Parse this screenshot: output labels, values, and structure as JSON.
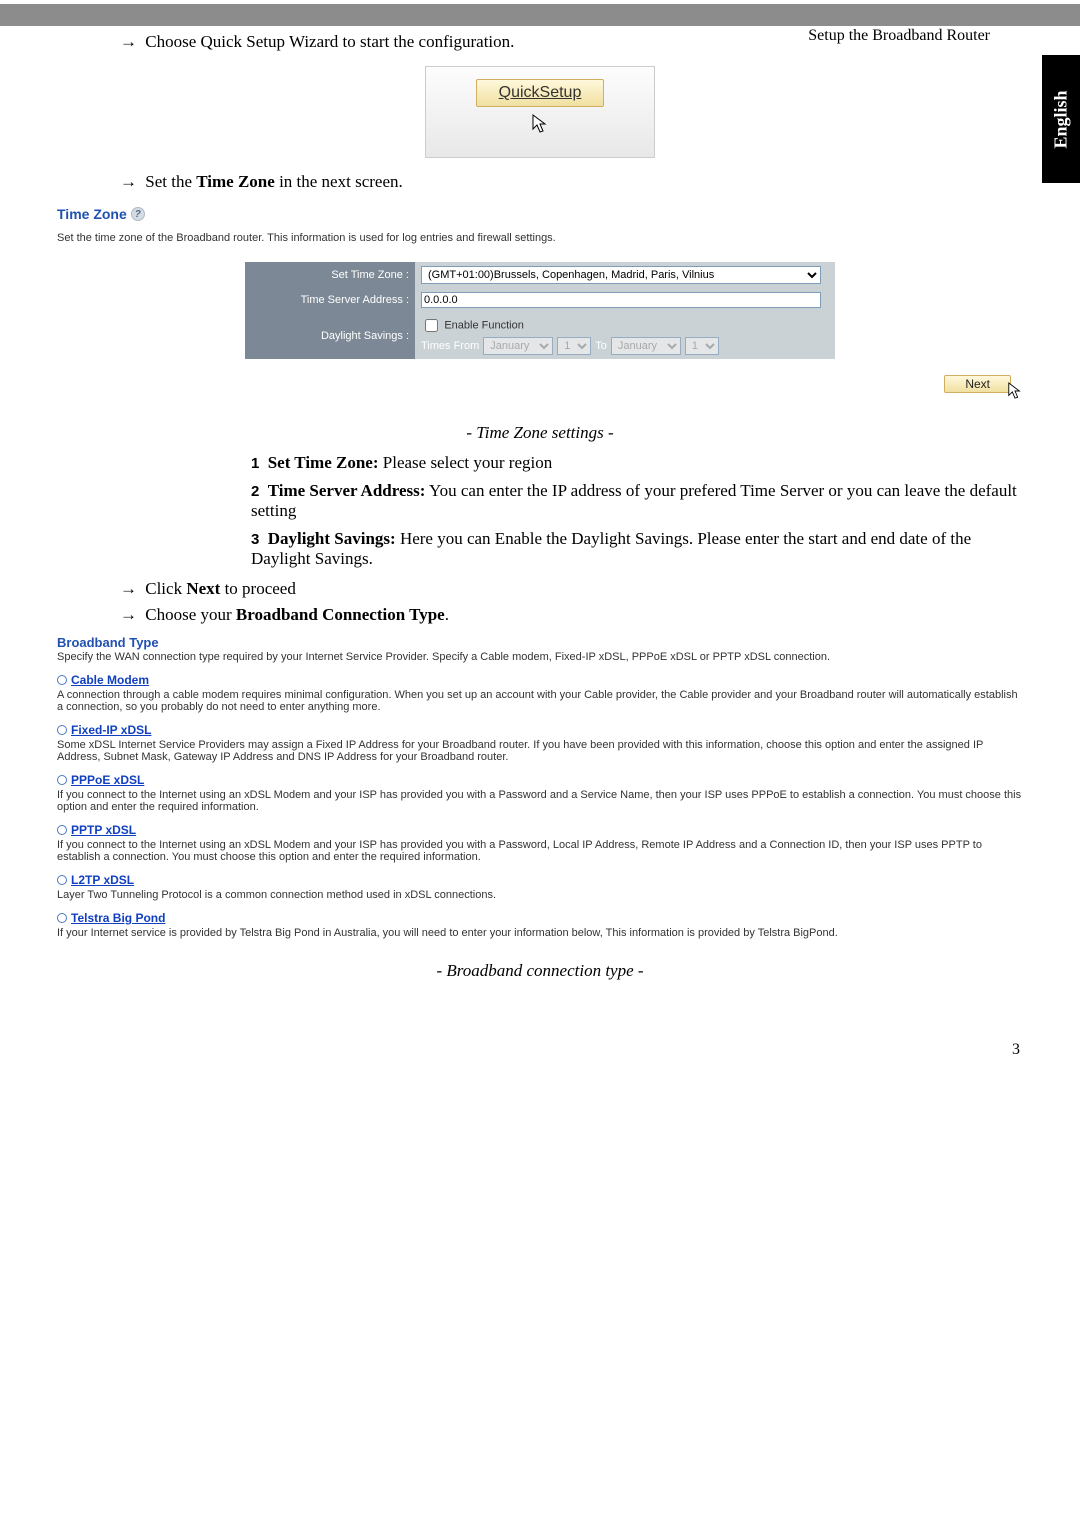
{
  "header": {
    "title": "Setup the Broadband Router",
    "language_tab": "English"
  },
  "intro": {
    "step1": "Choose Quick Setup Wizard to start the configuration.",
    "quick_setup_button": "QuickSetup",
    "step2_prefix": "Set the ",
    "step2_bold": "Time Zone",
    "step2_suffix": " in the next screen."
  },
  "timezone_panel": {
    "title": "Time Zone",
    "desc": "Set the time zone of the Broadband router. This information is used for log entries and firewall settings.",
    "rows": {
      "set_tz_label": "Set Time Zone :",
      "set_tz_value": "(GMT+01:00)Brussels, Copenhagen, Madrid, Paris, Vilnius",
      "tsa_label": "Time Server Address :",
      "tsa_value": "0.0.0.0",
      "ds_label": "Daylight Savings :",
      "ds_enable": "Enable Function",
      "ds_from": "Times From",
      "ds_to": "To",
      "month1": "January",
      "day1": "1",
      "month2": "January",
      "day2": "1"
    },
    "next_button": "Next"
  },
  "captions": {
    "tz": "- Time Zone settings -",
    "bt": "- Broadband connection type -"
  },
  "numbered": [
    {
      "label": "Set Time Zone:",
      "text": " Please select your region"
    },
    {
      "label": "Time Server Address:",
      "text": " You can enter the IP address of your prefered Time Server or you can leave the default setting"
    },
    {
      "label": "Daylight Savings:",
      "text": " Here you can Enable the Daylight Savings. Please enter the start and end date of the Daylight Savings."
    }
  ],
  "after_list": {
    "click_next_prefix": "Click ",
    "click_next_bold": "Next",
    "click_next_suffix": " to proceed",
    "choose_bct_prefix": "Choose your ",
    "choose_bct_bold": "Broadband Connection Type",
    "choose_bct_suffix": "."
  },
  "broadband": {
    "title": "Broadband Type",
    "intro": "Specify the WAN connection type required by your Internet Service Provider. Specify a Cable modem, Fixed-IP xDSL, PPPoE xDSL or PPTP xDSL connection.",
    "options": [
      {
        "name": " Cable Modem",
        "text": "A connection through a cable modem requires minimal configuration. When you set up an account with your Cable provider, the Cable provider and your Broadband router will automatically establish a connection, so you probably do not need to enter anything more."
      },
      {
        "name": " Fixed-IP xDSL",
        "text": "Some xDSL Internet Service Providers may assign a Fixed IP Address for your Broadband router. If you have been provided with this information, choose this option and enter the assigned IP Address, Subnet Mask, Gateway IP Address and DNS IP Address for your Broadband router."
      },
      {
        "name": " PPPoE xDSL",
        "text": "If you connect to the Internet using an xDSL Modem and your ISP has provided you with a Password and a Service Name, then your ISP uses PPPoE to establish a connection. You must choose this option and enter the required information."
      },
      {
        "name": " PPTP xDSL",
        "text": "If you connect to the Internet using an xDSL Modem and your ISP has provided you with a Password, Local IP Address, Remote IP Address and a Connection ID, then your ISP uses PPTP to establish a connection. You must choose this option and enter the required information."
      },
      {
        "name": " L2TP xDSL",
        "text": "Layer Two Tunneling Protocol is a common connection method used in xDSL connections."
      },
      {
        "name": " Telstra Big Pond",
        "text": "If your Internet service is provided by Telstra Big Pond in Australia, you will need to enter your information below, This information is provided by Telstra BigPond."
      }
    ]
  },
  "footer": {
    "page_number": "3"
  }
}
